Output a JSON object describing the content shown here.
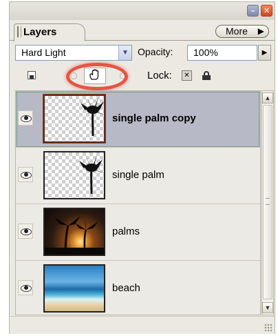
{
  "panel": {
    "tab_label": "Layers",
    "more_label": "More",
    "more_arrow": "▶",
    "window_minimize": "–",
    "window_close": "✕"
  },
  "blend": {
    "mode": "Hard Light",
    "dropdown_arrow": "▼"
  },
  "opacity": {
    "label": "Opacity:",
    "value": "100%",
    "arrow": "▶"
  },
  "lock": {
    "label": "Lock:",
    "position_icon": "hand-icon"
  },
  "layers": [
    {
      "name": "single palm copy",
      "selected": true,
      "visible": true,
      "thumbnail": "palm-on-transparent"
    },
    {
      "name": "single palm",
      "selected": false,
      "visible": true,
      "thumbnail": "palm-on-transparent"
    },
    {
      "name": "palms",
      "selected": false,
      "visible": true,
      "thumbnail": "palms-sunset"
    },
    {
      "name": "beach",
      "selected": false,
      "visible": true,
      "thumbnail": "ocean-beach"
    }
  ],
  "scrollbar": {
    "up": "▲",
    "down": "▼"
  },
  "colors": {
    "panel_bg": "#ece9e2",
    "selected_row": "#b7b9c7",
    "highlight_annotation": "#e23c28"
  }
}
